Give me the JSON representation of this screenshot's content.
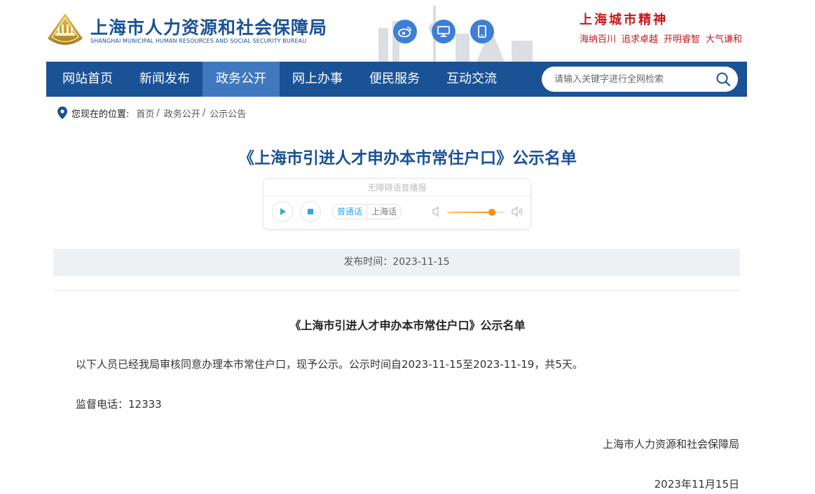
{
  "header": {
    "site_title": "上海市人力资源和社会保障局",
    "site_subtitle": "SHANGHAI MUNICIPAL HUMAN RESOURCES AND SOCIAL SECURITY BUREAU",
    "icons": [
      "weibo-icon",
      "desktop-icon",
      "mobile-icon"
    ],
    "spirit_title": "上海城市精神",
    "spirit_tags": [
      "海纳百川",
      "追求卓越",
      "开明睿智",
      "大气谦和"
    ]
  },
  "nav": {
    "items": [
      "网站首页",
      "新闻发布",
      "政务公开",
      "网上办事",
      "便民服务",
      "互动交流"
    ],
    "active_index": 2,
    "search_placeholder": "请输入关键字进行全网检索"
  },
  "breadcrumb": {
    "label": "您现在的位置:",
    "items": [
      "首页",
      "政务公开",
      "公示公告"
    ]
  },
  "page_title": "《上海市引进人才申办本市常住户口》公示名单",
  "player": {
    "label": "无障碍语音播报",
    "lang_mandarin": "普通话",
    "lang_shanghainese": "上海话",
    "volume": 0.78
  },
  "publish": {
    "text": "发布时间：2023-11-15"
  },
  "article": {
    "title": "《上海市引进人才申办本市常住户口》公示名单",
    "paragraph1": "以下人员已经我局审核同意办理本市常住户口，现予公示。公示时间自2023-11-15至2023-11-19，共5天。",
    "paragraph2": "监督电话：12333",
    "signature": "上海市人力资源和社会保障局",
    "date": "2023年11月15日"
  },
  "colors": {
    "brand": "#1a5296",
    "nav_active": "#3f78bf",
    "spirit_red": "#c9161d",
    "icon_blue": "#3d7fd6",
    "player_accent": "#2fa8e0",
    "volume_orange": "#ff8c1a"
  }
}
